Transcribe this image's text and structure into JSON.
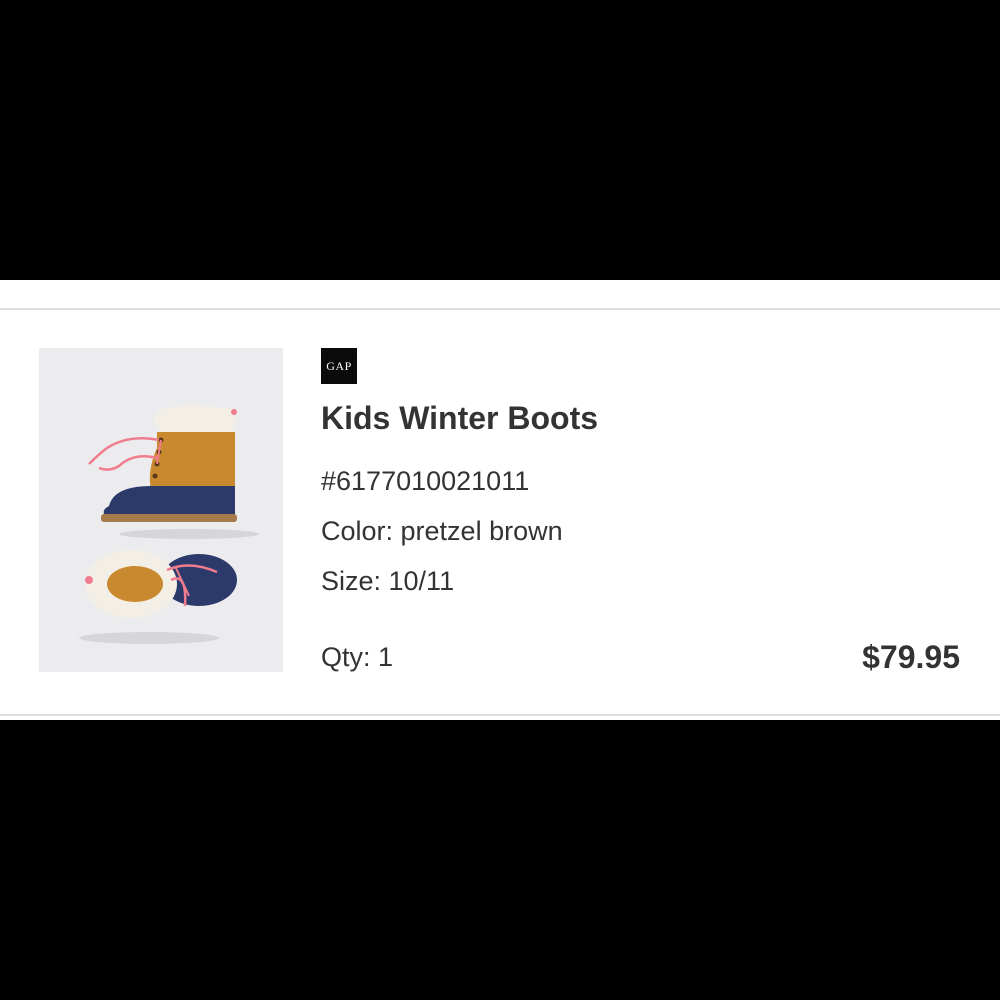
{
  "brand": {
    "logo_text": "GAP"
  },
  "product": {
    "name": "Kids Winter Boots",
    "sku": "#6177010021011",
    "color_line": "Color: pretzel brown",
    "size_line": "Size: 10/11",
    "qty_line": "Qty: 1",
    "price": "$79.95",
    "image_icon": "boots-product-image"
  },
  "colors": {
    "background": "#000000",
    "card": "#ffffff",
    "divider": "#dcdcdc",
    "text": "#333333",
    "thumb_bg": "#ececee",
    "boot_upper": "#c9892f",
    "boot_lower": "#2b3a6b",
    "laces": "#f07c8e",
    "fur": "#f4efe6"
  }
}
